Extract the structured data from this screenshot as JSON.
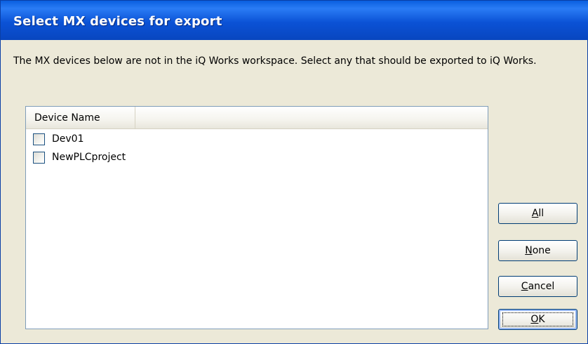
{
  "window": {
    "title": "Select MX devices for export"
  },
  "description": "The MX devices below are not in the iQ Works workspace. Select any that should be exported to iQ Works.",
  "list": {
    "columns": [
      "Device Name"
    ],
    "rows": [
      {
        "label": "Dev01",
        "checked": false
      },
      {
        "label": "NewPLCproject",
        "checked": false
      }
    ]
  },
  "buttons": {
    "all": {
      "pre": "",
      "accel": "A",
      "post": "ll"
    },
    "none": {
      "pre": "",
      "accel": "N",
      "post": "one"
    },
    "cancel": {
      "pre": "",
      "accel": "C",
      "post": "ancel"
    },
    "ok": {
      "pre": "",
      "accel": "O",
      "post": "K"
    }
  },
  "colors": {
    "titlebar": "#0b52d6",
    "dialog_bg": "#ece9d8",
    "border": "#003c74"
  }
}
